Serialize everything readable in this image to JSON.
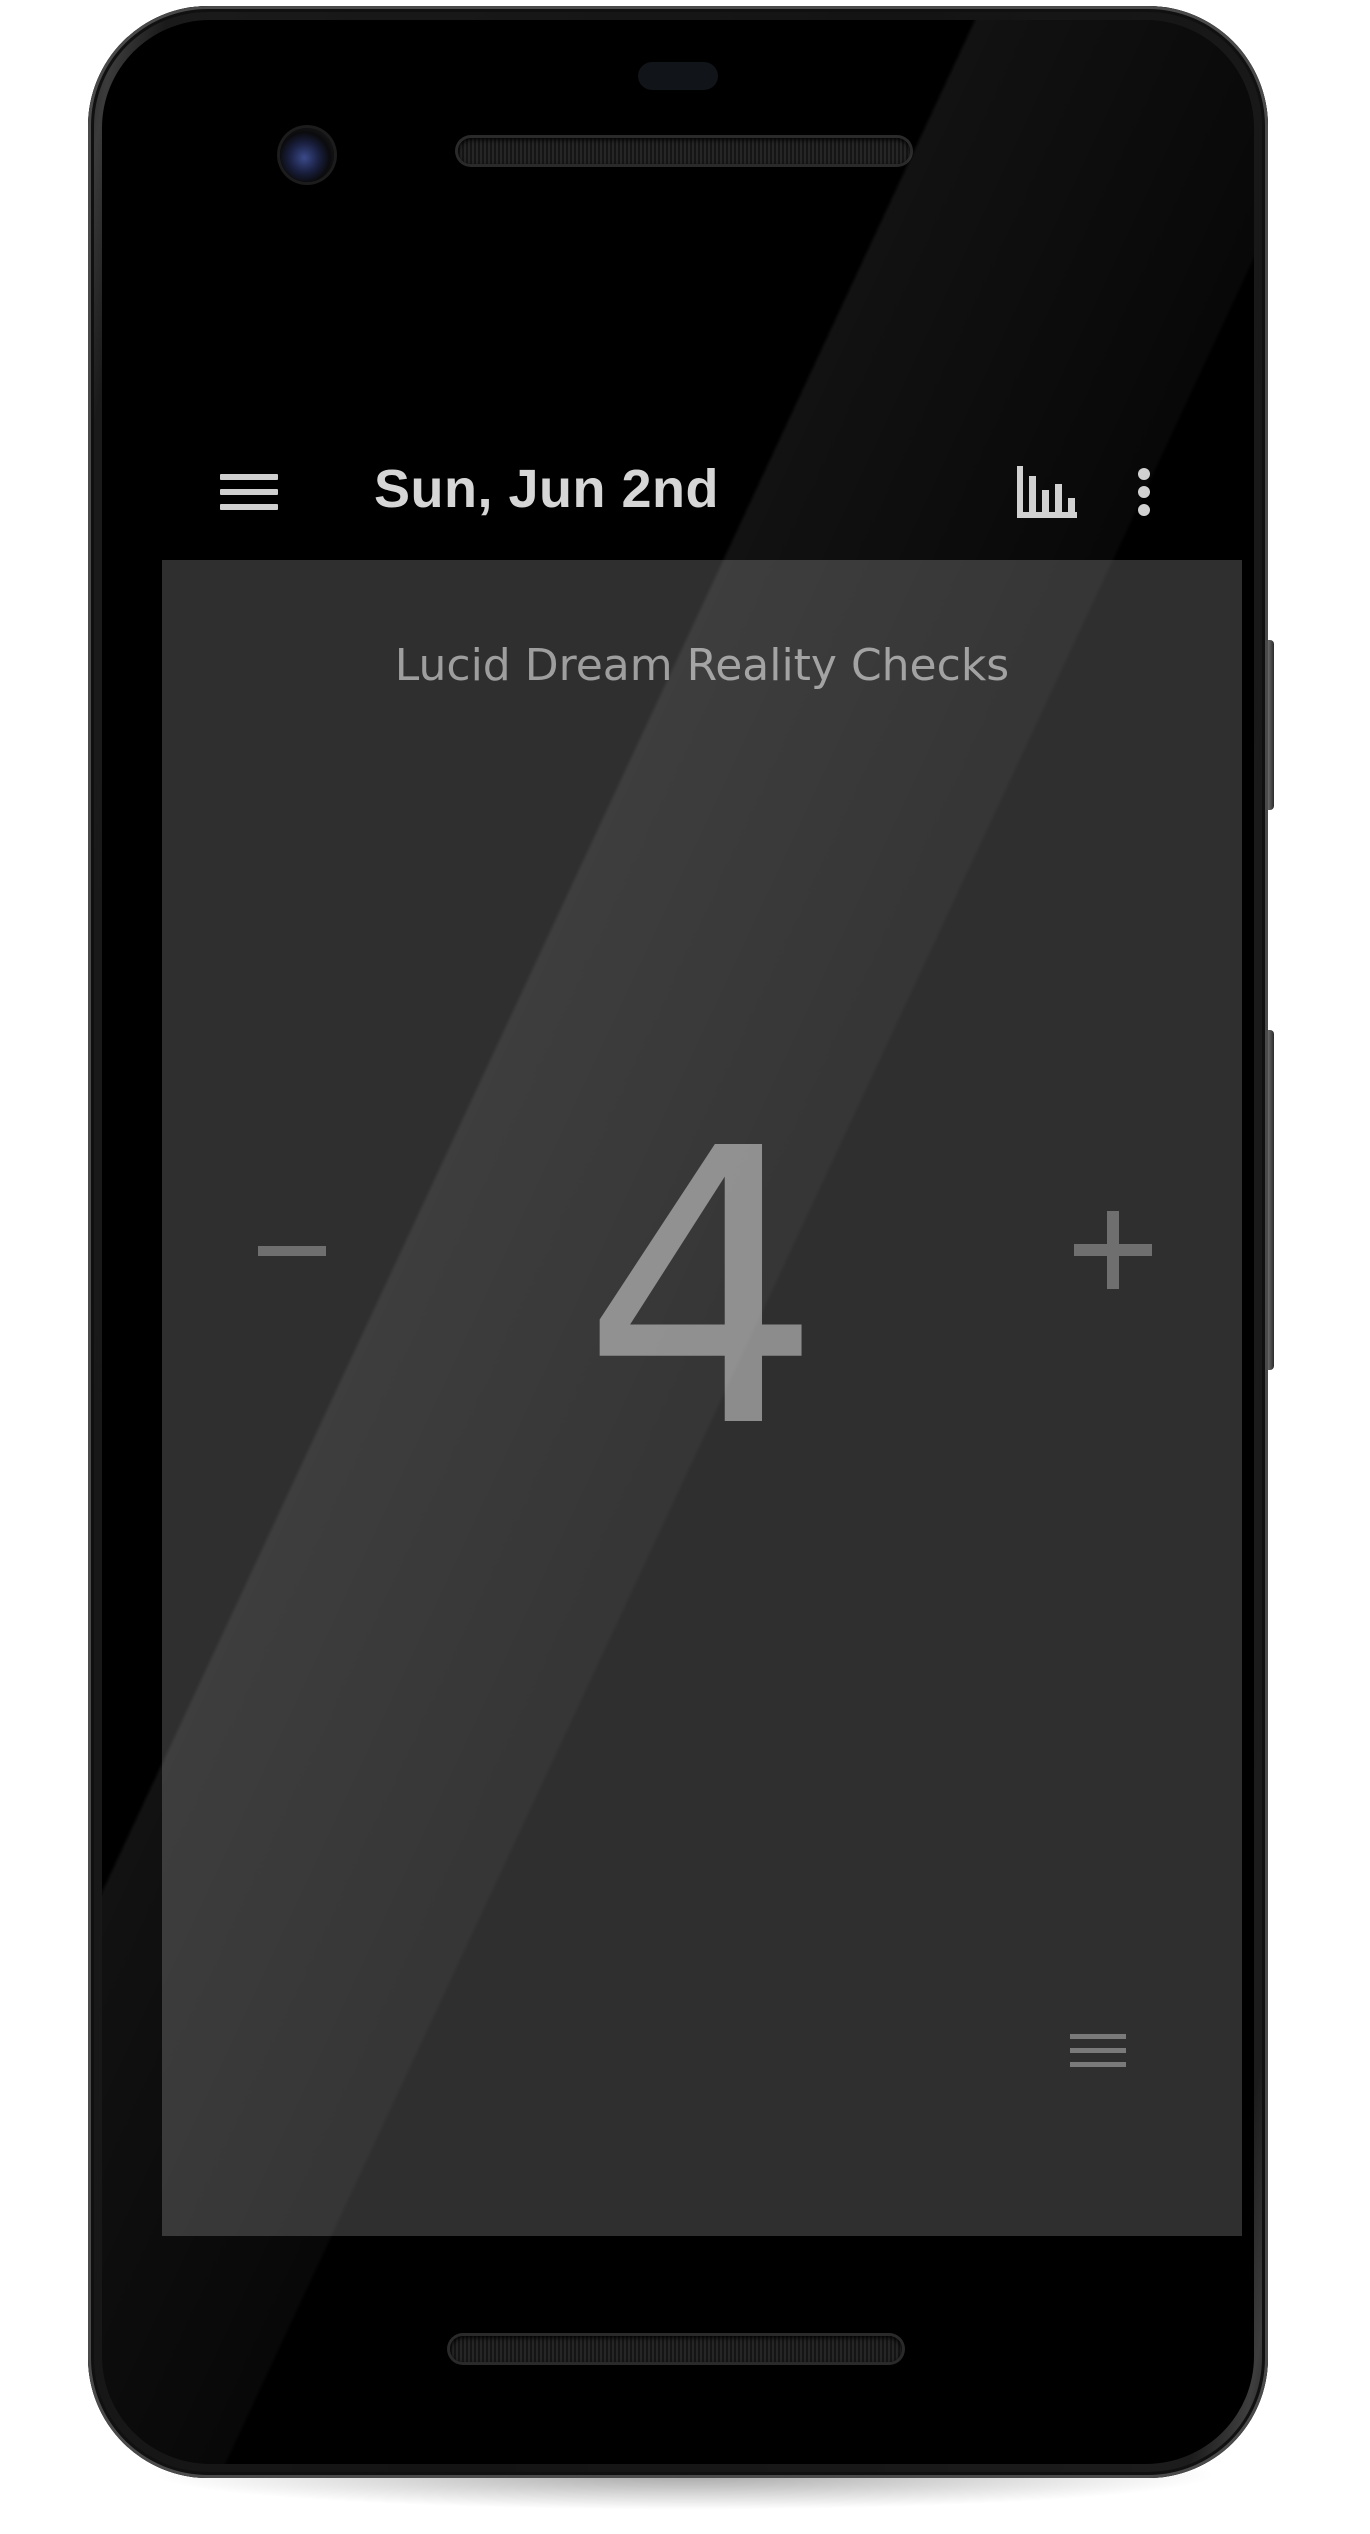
{
  "app": {
    "date_title": "Sun, Jun 2nd"
  },
  "icons": {
    "menu": "hamburger-menu-icon",
    "stats": "bar-chart-icon",
    "more": "more-vert-icon",
    "decrement": "minus-icon",
    "increment": "plus-icon",
    "list": "list-icon"
  },
  "counter": {
    "name": "Lucid Dream Reality Checks",
    "value": "4",
    "decrement_label": "−",
    "increment_label": "+"
  },
  "colors": {
    "screen_background": "#2e2e2e",
    "appbar_background": "#000000",
    "title_text": "#d6d6d6",
    "counter_text": "#8c8c8c",
    "control_grey": "#6f6f6f"
  }
}
